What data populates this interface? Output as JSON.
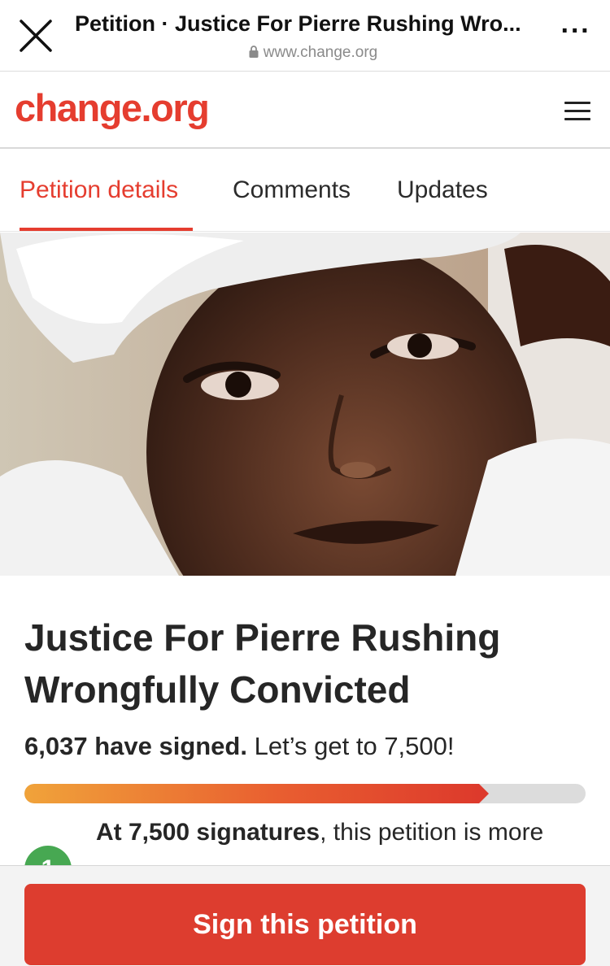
{
  "browser": {
    "title": "Petition · Justice For Pierre Rushing Wro...",
    "url": "www.change.org"
  },
  "site": {
    "logo": "change.org"
  },
  "tabs": [
    {
      "label": "Petition details",
      "active": true
    },
    {
      "label": "Comments",
      "active": false
    },
    {
      "label": "Updates",
      "active": false
    }
  ],
  "petition": {
    "title": "Justice For Pierre Rushing Wrongfully Convicted",
    "signed_count": "6,037 have signed.",
    "goal_text": "Let’s get to 7,500!",
    "progress_fraction": 0.81,
    "milestone_bold": "At 7,500 signatures",
    "milestone_rest": ", this petition is more",
    "step_number": "1"
  },
  "cta": {
    "sign_label": "Sign this petition"
  },
  "colors": {
    "brand": "#e53d2f",
    "button": "#dd3d2f",
    "badge": "#47a852"
  },
  "icons": [
    "close-icon",
    "lock-icon",
    "more-icon",
    "menu-icon"
  ]
}
